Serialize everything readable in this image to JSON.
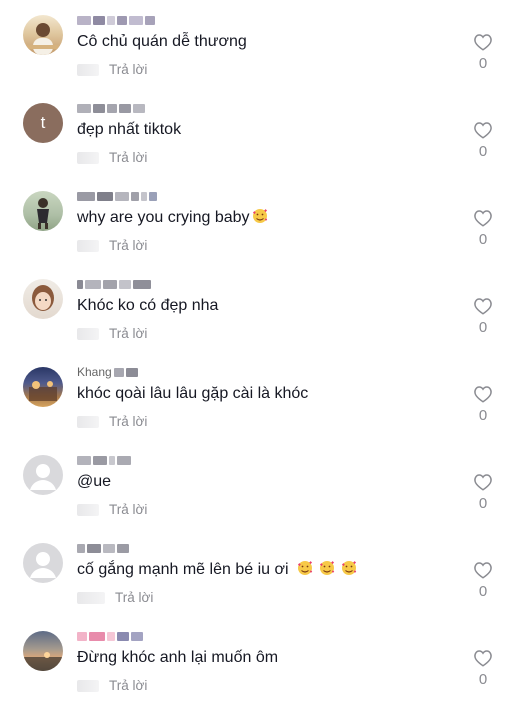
{
  "comments": [
    {
      "text": "Cô chủ quán dễ thương",
      "reply": "Trả lời",
      "likes": "0",
      "avatar": "photo-portrait"
    },
    {
      "text": "đẹp nhất tiktok",
      "reply": "Trả lời",
      "likes": "0",
      "avatar_letter": "t"
    },
    {
      "text": "why are you crying baby",
      "reply": "Trả lời",
      "likes": "0",
      "avatar": "photo-child"
    },
    {
      "text": "Khóc ko có đẹp nha",
      "reply": "Trả lời",
      "likes": "0",
      "avatar": "photo-girl"
    },
    {
      "text": "khóc qoài lâu lâu gặp cài là khóc",
      "reply": "Trả lời",
      "likes": "0",
      "avatar": "photo-scene",
      "username_partial": "Khang"
    },
    {
      "text": "@ue",
      "reply": "Trả lời",
      "likes": "0",
      "avatar": "default-user"
    },
    {
      "text": "cố gắng mạnh mẽ lên bé iu ơi",
      "reply": "Trả lời",
      "likes": "0",
      "avatar": "default-user"
    },
    {
      "text": "Đừng khóc anh lại muốn ôm",
      "reply": "Trả lời",
      "likes": "0",
      "avatar": "photo-sunset"
    }
  ],
  "icons": {
    "like": "heart-outline-icon",
    "emoji": "smiling-face-with-hearts-icon"
  },
  "colors": {
    "text": "#161823",
    "muted": "#8a8b91"
  }
}
